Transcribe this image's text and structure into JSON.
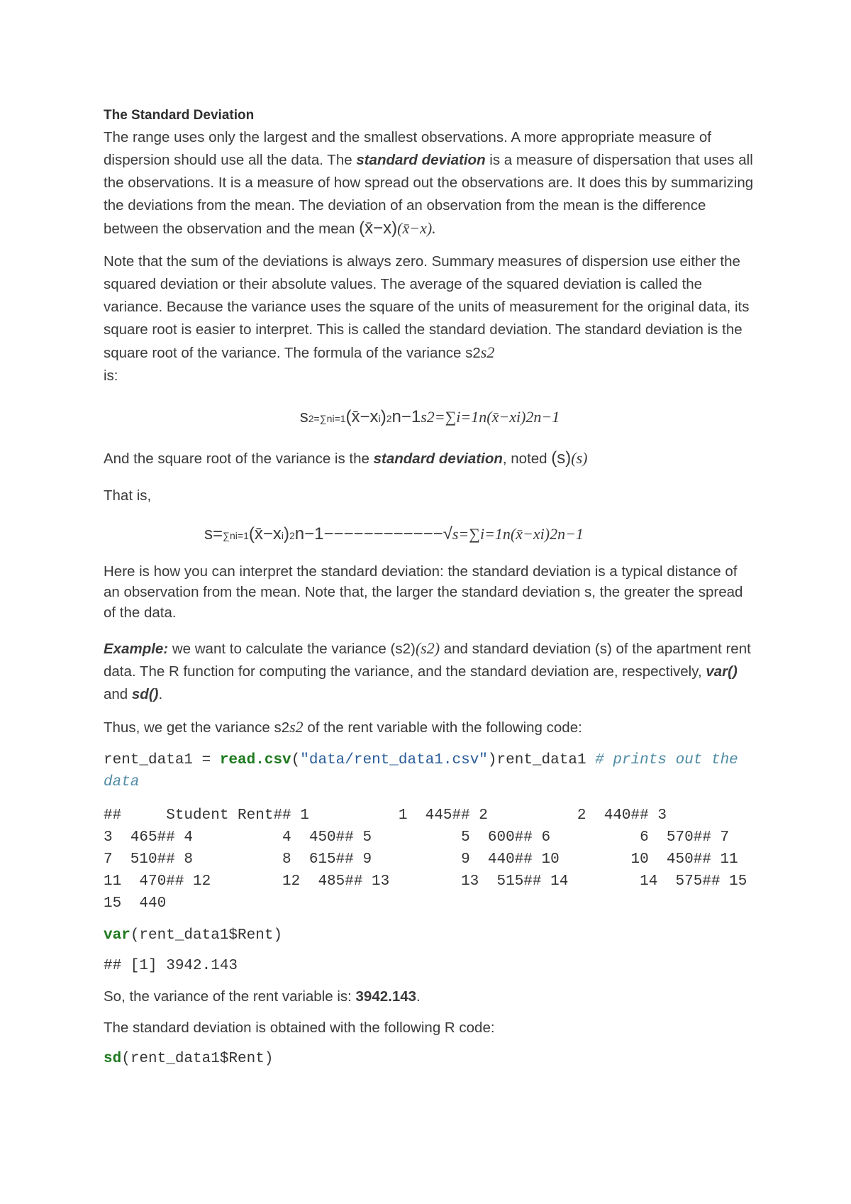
{
  "heading": "The Standard Deviation",
  "para1": {
    "a": "The range uses only the largest and the smallest observations. A more appropriate measure of dispersion should use all the data. The ",
    "em": "standard deviation",
    "b": " is a measure of dispersation that uses all the observations. It is a measure of how spread out the observations are. It does this by summarizing the deviations from the mean. The deviation of an observation from the mean is the difference between the observation and the mean ",
    "math_up": "(x̄−x)",
    "math_it": "(x̄−x)."
  },
  "para2": {
    "text": "Note that the sum of the deviations is always zero. Summary measures of dispersion use either the squared deviation or their absolute values. The average of the squared deviation is called the variance. Because the variance uses the square of the units of measurement for the original data, its square root is easier to interpret. This is called the standard deviation. The standard deviation is the square root of the variance. The formula of the variance ",
    "math_up": "s2",
    "math_it": "s2",
    "tail": " is:"
  },
  "formula_variance": {
    "up_a": "s",
    "up_b": "2=∑ni=1",
    "up_c": "(x̄−x",
    "up_d": "i",
    "up_e": ")",
    "up_f": "2",
    "up_g": "n−1",
    "it": "s2=∑i=1n(x̄−xi)2n−1"
  },
  "para3": {
    "a": "And the square root of the variance is the ",
    "em": "standard deviation",
    "b": ", noted ",
    "math_up": "(s)",
    "math_it": "(s)"
  },
  "para4": "That is,",
  "formula_sd": {
    "up_a": "s=",
    "up_b": "∑ni=1",
    "up_c": "(x̄−x",
    "up_d": "i",
    "up_e": ")",
    "up_f": "2",
    "up_g": "n−1−−−−−−−−−−−−√",
    "it": "s=∑i=1n(x̄−xi)2n−1"
  },
  "para5": "Here is how you can interpret the standard deviation: the standard deviation is a typical distance of an observation from the mean. Note that, the larger the standard deviation s, the greater the spread of the data.",
  "para6": {
    "label": "Example:",
    "a": " we want to calculate the variance ",
    "math_up": "(s2)",
    "math_it": "(s2)",
    "b": " and standard deviation (s) of the apartment rent data. The R function for computing the variance, and the standard deviation are, respectively, ",
    "fn1": "var()",
    "c": " and ",
    "fn2": "sd()",
    "d": "."
  },
  "para7": {
    "a": "Thus, we get the variance ",
    "math_up": "s2",
    "math_it": "s2",
    "b": " of the rent variable with the following code:"
  },
  "code1": {
    "var": "rent_data1 = ",
    "fn": "read.csv",
    "open": "(",
    "str": "\"data/rent_data1.csv\"",
    "close": ")rent_data1 ",
    "comment": "# prints out the data"
  },
  "output1": "##     Student Rent## 1          1  445## 2          2  440## 3          3  465## 4          4  450## 5          5  600## 6          6  570## 7          7  510## 8          8  615## 9          9  440## 10        10  450## 11        11  470## 12        12  485## 13        13  515## 14        14  575## 15        15  440",
  "code2": {
    "fn": "var",
    "args": "(rent_data1$Rent)"
  },
  "output2": "## [1] 3942.143",
  "para8": {
    "a": "So, the variance of the rent variable is: ",
    "value": "3942.143",
    "b": "."
  },
  "para9": "The standard deviation is obtained with the following R code:",
  "code3": {
    "fn": "sd",
    "args": "(rent_data1$Rent)"
  }
}
